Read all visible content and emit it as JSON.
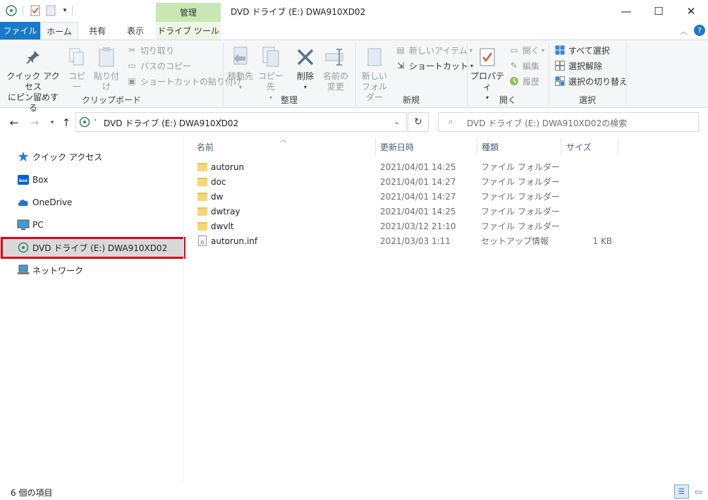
{
  "window": {
    "title": "DVD ドライブ (E:) DWA910XD02",
    "context_tab": "管理",
    "minimize": "—",
    "maximize": "☐",
    "close": "✕"
  },
  "ribbon_tabs": [
    {
      "label": "ファイル"
    },
    {
      "label": "ホーム"
    },
    {
      "label": "共有"
    },
    {
      "label": "表示"
    },
    {
      "label": "ドライブ ツール"
    }
  ],
  "ribbon": {
    "clipboard": {
      "pin_line1": "クイック アクセス",
      "pin_line2": "にピン留めする",
      "copy": "コピー",
      "paste": "貼り付け",
      "cut": "切り取り",
      "copy_path": "パスのコピー",
      "paste_shortcut": "ショートカットの貼り付け",
      "label": "クリップボード"
    },
    "organize": {
      "move_to": "移動先",
      "copy_to": "コピー先",
      "delete": "削除",
      "rename_line1": "名前の",
      "rename_line2": "変更",
      "label": "整理"
    },
    "new": {
      "new_folder_line1": "新しい",
      "new_folder_line2": "フォルダー",
      "new_item": "新しいアイテム",
      "shortcut": "ショートカット",
      "label": "新規"
    },
    "open": {
      "properties": "プロパティ",
      "open": "開く",
      "edit": "編集",
      "history": "履歴",
      "label": "開く"
    },
    "select": {
      "select_all": "すべて選択",
      "select_none": "選択解除",
      "invert": "選択の切り替え",
      "label": "選択"
    }
  },
  "address": {
    "path": "DVD ドライブ (E:) DWA910XD02",
    "search_placeholder": "DVD ドライブ (E:) DWA910XD02の検索"
  },
  "nav_pane": [
    {
      "label": "クイック アクセス",
      "icon": "star-icon"
    },
    {
      "label": "Box",
      "icon": "box-icon"
    },
    {
      "label": "OneDrive",
      "icon": "cloud-icon"
    },
    {
      "label": "PC",
      "icon": "pc-icon"
    },
    {
      "label": "DVD ドライブ (E:) DWA910XD02",
      "icon": "dvd-icon",
      "selected": true
    },
    {
      "label": "ネットワーク",
      "icon": "network-icon"
    }
  ],
  "columns": {
    "name": "名前",
    "date": "更新日時",
    "type": "種類",
    "size": "サイズ"
  },
  "files": [
    {
      "name": "autorun",
      "date": "2021/04/01 14:25",
      "type": "ファイル フォルダー",
      "size": "",
      "kind": "folder"
    },
    {
      "name": "doc",
      "date": "2021/04/01 14:27",
      "type": "ファイル フォルダー",
      "size": "",
      "kind": "folder"
    },
    {
      "name": "dw",
      "date": "2021/04/01 14:27",
      "type": "ファイル フォルダー",
      "size": "",
      "kind": "folder"
    },
    {
      "name": "dwtray",
      "date": "2021/04/01 14:25",
      "type": "ファイル フォルダー",
      "size": "",
      "kind": "folder"
    },
    {
      "name": "dwvlt",
      "date": "2021/03/12 21:10",
      "type": "ファイル フォルダー",
      "size": "",
      "kind": "folder"
    },
    {
      "name": "autorun.inf",
      "date": "2021/03/03 1:11",
      "type": "セットアップ情報",
      "size": "1 KB",
      "kind": "file"
    }
  ],
  "status": {
    "item_count": "6 個の項目"
  },
  "colors": {
    "file_tab": "#1979ca",
    "context_tab": "#c9e7b3",
    "highlight": "#e0001b",
    "selected": "#d9d9d9"
  }
}
